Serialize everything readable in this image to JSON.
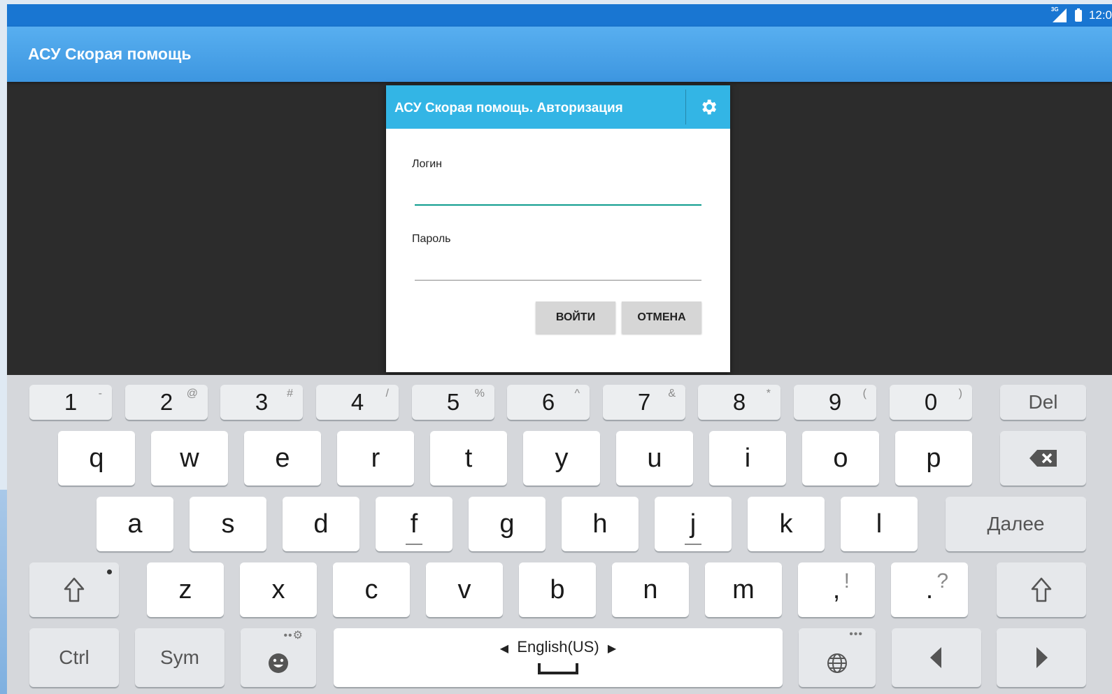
{
  "status_bar": {
    "network": "3G",
    "time": "12:0"
  },
  "action_bar": {
    "title": "АСУ Скорая помощь"
  },
  "dialog": {
    "title": "АСУ Скорая помощь. Авторизация",
    "login_label": "Логин",
    "login_value": "",
    "password_label": "Пароль",
    "password_value": "",
    "login_button": "ВОЙТИ",
    "cancel_button": "ОТМЕНА"
  },
  "keyboard": {
    "number_row": [
      {
        "main": "1",
        "sub": "-"
      },
      {
        "main": "2",
        "sub": "@"
      },
      {
        "main": "3",
        "sub": "#"
      },
      {
        "main": "4",
        "sub": "/"
      },
      {
        "main": "5",
        "sub": "%"
      },
      {
        "main": "6",
        "sub": "^"
      },
      {
        "main": "7",
        "sub": "&"
      },
      {
        "main": "8",
        "sub": "*"
      },
      {
        "main": "9",
        "sub": "("
      },
      {
        "main": "0",
        "sub": ")"
      }
    ],
    "del_label": "Del",
    "row1": [
      "q",
      "w",
      "e",
      "r",
      "t",
      "y",
      "u",
      "i",
      "o",
      "p"
    ],
    "row2": [
      "a",
      "s",
      "d",
      "f",
      "g",
      "h",
      "j",
      "k",
      "l"
    ],
    "next_label": "Далее",
    "row3": [
      "z",
      "x",
      "c",
      "v",
      "b",
      "n",
      "m"
    ],
    "comma_key": {
      "main": ",",
      "sub": "!"
    },
    "period_key": {
      "main": ".",
      "sub": "?"
    },
    "ctrl_label": "Ctrl",
    "sym_label": "Sym",
    "space_language": "English(US)",
    "colors": {
      "accent": "#33b5e5",
      "appbar": "#3d96e0",
      "statusbar": "#1976d2",
      "underline": "#0f9d8f"
    }
  }
}
